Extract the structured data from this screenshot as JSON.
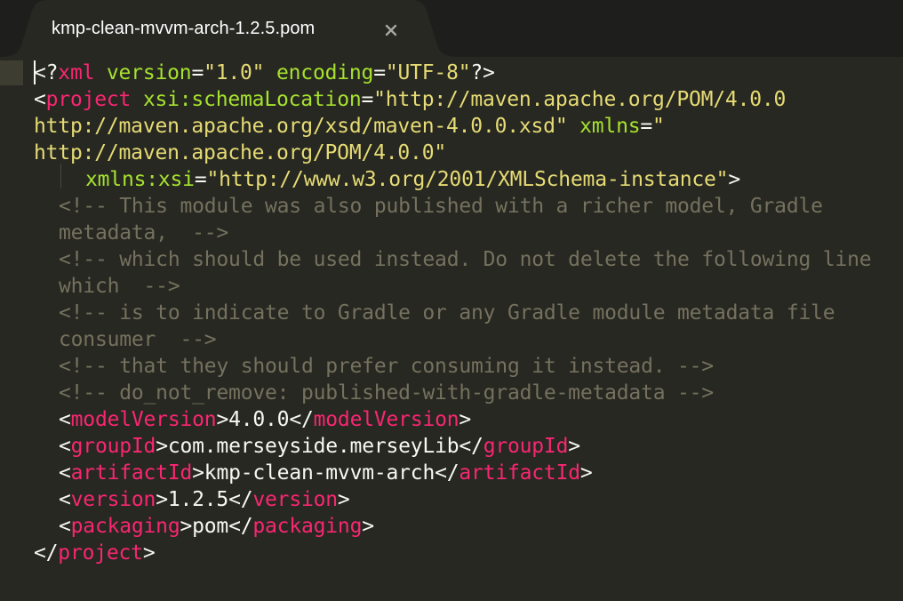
{
  "tab": {
    "title": "kmp-clean-mvvm-arch-1.2.5.pom",
    "close_glyph": "×"
  },
  "colors": {
    "background": "#272822",
    "tabbar": "#1e1f1c",
    "tag": "#f92672",
    "attribute": "#a6e22e",
    "string": "#e6db74",
    "comment": "#75715e",
    "text": "#f8f8f2"
  },
  "code": {
    "decl": {
      "open": "<?",
      "name": "xml",
      "attr1": "version",
      "eq1": "=",
      "val1": "\"1.0\"",
      "attr2": "encoding",
      "eq2": "=",
      "val2": "\"UTF-8\"",
      "close": "?>"
    },
    "project_open": {
      "lt": "<",
      "name": "project",
      "attr1": "xsi:schemaLocation",
      "eq1": "=",
      "val1_a": "\"http://maven.apache.org/POM/4.0.0",
      "val1_b": "http://maven.apache.org/xsd/maven-4.0.0.xsd\"",
      "attr2": "xmlns",
      "eq2": "=",
      "val2_a": "\"",
      "val2_b": "http://maven.apache.org/POM/4.0.0\"",
      "attr3": "xmlns:xsi",
      "eq3": "=",
      "val3": "\"http://www.w3.org/2001/XMLSchema-instance\"",
      "gt": ">"
    },
    "comments": [
      "<!-- This module was also published with a richer model, Gradle",
      "metadata,  -->",
      "<!-- which should be used instead. Do not delete the following line",
      "which  -->",
      "<!-- is to indicate to Gradle or any Gradle module metadata file",
      "consumer  -->",
      "<!-- that they should prefer consuming it instead. -->",
      "<!-- do_not_remove: published-with-gradle-metadata -->"
    ],
    "elements": [
      {
        "lt": "<",
        "tag": "modelVersion",
        "gt": ">",
        "value": "4.0.0",
        "clt": "</",
        "ctag": "modelVersion",
        "cgt": ">"
      },
      {
        "lt": "<",
        "tag": "groupId",
        "gt": ">",
        "value": "com.merseyside.merseyLib",
        "clt": "</",
        "ctag": "groupId",
        "cgt": ">"
      },
      {
        "lt": "<",
        "tag": "artifactId",
        "gt": ">",
        "value": "kmp-clean-mvvm-arch",
        "clt": "</",
        "ctag": "artifactId",
        "cgt": ">"
      },
      {
        "lt": "<",
        "tag": "version",
        "gt": ">",
        "value": "1.2.5",
        "clt": "</",
        "ctag": "version",
        "cgt": ">"
      },
      {
        "lt": "<",
        "tag": "packaging",
        "gt": ">",
        "value": "pom",
        "clt": "</",
        "ctag": "packaging",
        "cgt": ">"
      }
    ],
    "project_close": {
      "lt": "</",
      "name": "project",
      "gt": ">"
    }
  }
}
